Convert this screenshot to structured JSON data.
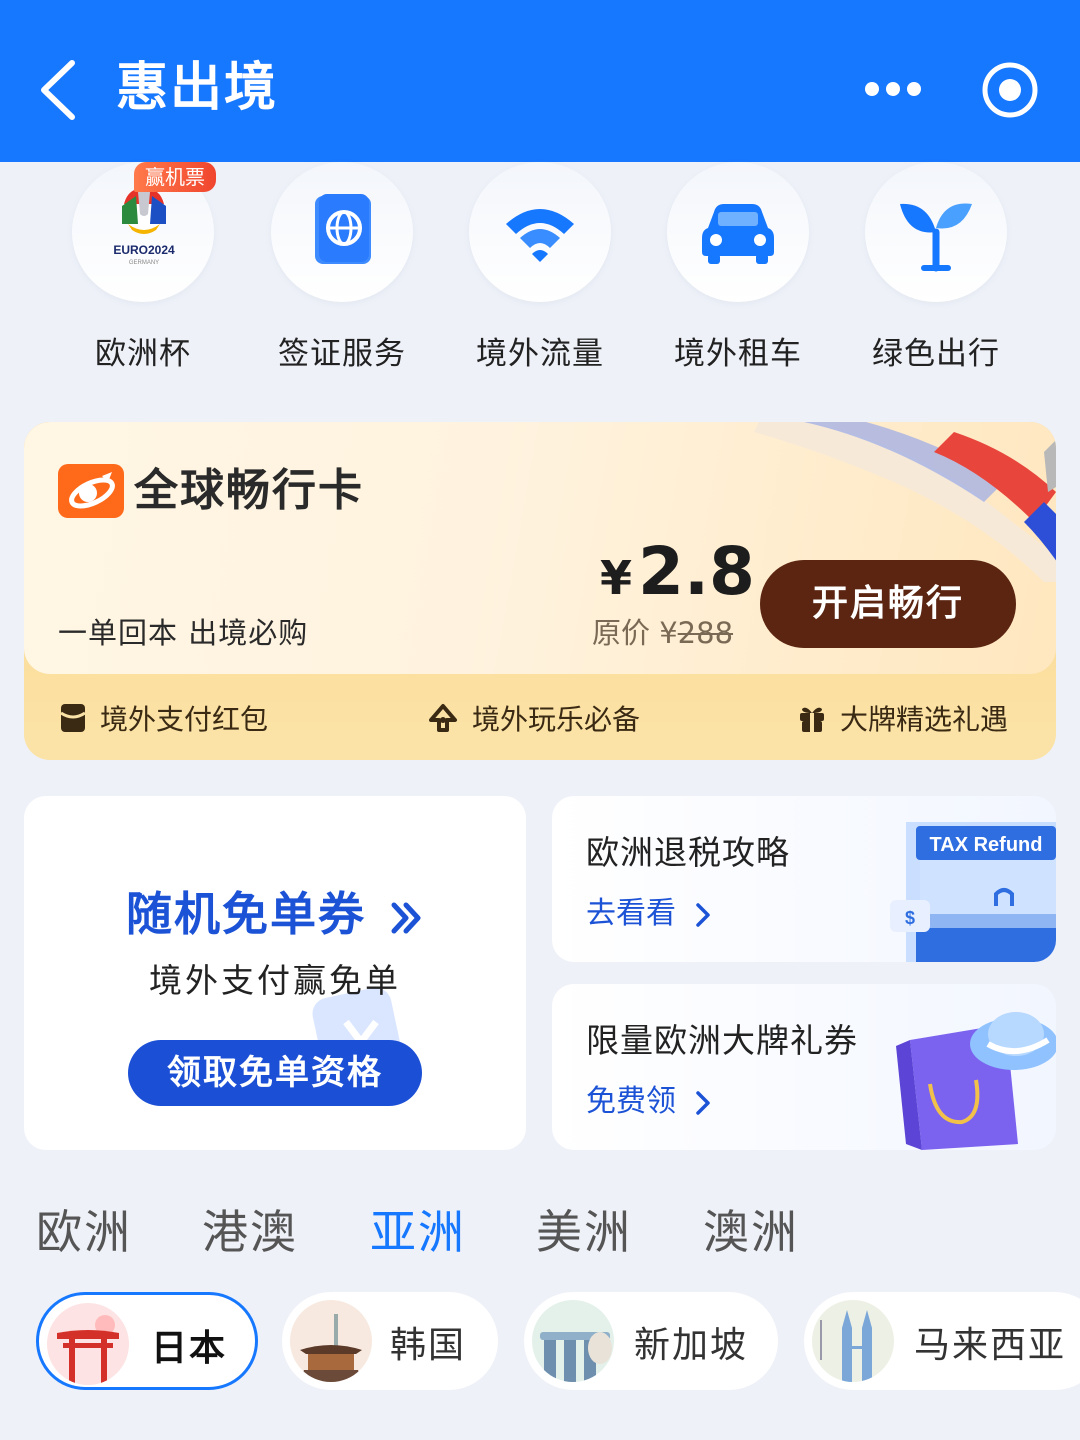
{
  "header": {
    "title": "惠出境"
  },
  "services": [
    {
      "label": "欧洲杯",
      "badge": "赢机票",
      "icon": "euro2024-logo-icon"
    },
    {
      "label": "签证服务",
      "icon": "passport-icon"
    },
    {
      "label": "境外流量",
      "icon": "wifi-icon"
    },
    {
      "label": "境外租车",
      "icon": "car-icon"
    },
    {
      "label": "绿色出行",
      "icon": "sprout-icon"
    }
  ],
  "global_card": {
    "title": "全球畅行卡",
    "subtitle": "一单回本 出境必购",
    "currency": "¥",
    "price": "2.8",
    "original_label": "原价 ¥",
    "original_price": "288",
    "button": "开启畅行",
    "perks": [
      {
        "label": "境外支付红包",
        "icon": "red-packet-icon"
      },
      {
        "label": "境外玩乐必备",
        "icon": "balloon-icon"
      },
      {
        "label": "大牌精选礼遇",
        "icon": "gift-icon"
      }
    ]
  },
  "coupon": {
    "title": "随机免单券",
    "subtitle": "境外支付赢免单",
    "button": "领取免单资格"
  },
  "side_cards": [
    {
      "title": "欧洲退税攻略",
      "link": "去看看",
      "art_text": "TAX Refund"
    },
    {
      "title": "限量欧洲大牌礼券",
      "link": "免费领"
    }
  ],
  "regions": {
    "tabs": [
      "欧洲",
      "港澳",
      "亚洲",
      "美洲",
      "澳洲"
    ],
    "active": "亚洲"
  },
  "countries": [
    {
      "name": "日本",
      "active": true
    },
    {
      "name": "韩国",
      "active": false
    },
    {
      "name": "新加坡",
      "active": false
    },
    {
      "name": "马来西亚",
      "active": false
    }
  ],
  "colors": {
    "primary": "#1677ff",
    "button_brown": "#5b2512",
    "coupon_blue": "#1b4fd6"
  }
}
